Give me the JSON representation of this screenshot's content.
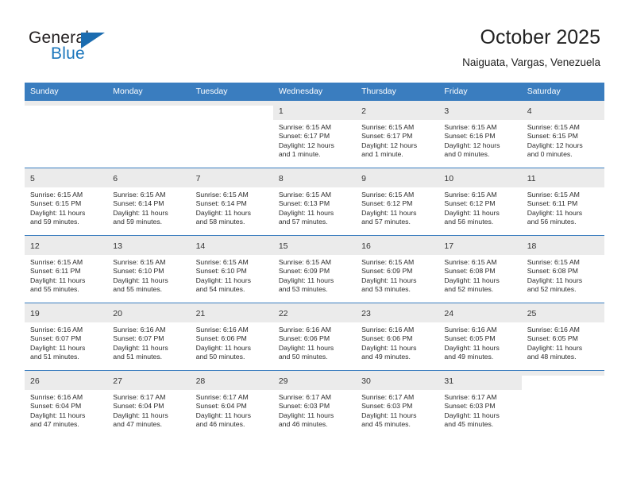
{
  "logo": {
    "word_top": "General",
    "word_bottom": "Blue",
    "triangle_icon": "triangle-icon",
    "brand_color": "#1b76bc"
  },
  "header": {
    "title": "October 2025",
    "subtitle": "Naiguata, Vargas, Venezuela"
  },
  "theme": {
    "header_bar_color": "#3a7dbf",
    "daynum_bar_color": "#ebebeb",
    "text_color": "#2b2b2b"
  },
  "weekday_headers": [
    "Sunday",
    "Monday",
    "Tuesday",
    "Wednesday",
    "Thursday",
    "Friday",
    "Saturday"
  ],
  "weeks": [
    [
      {
        "day": "",
        "sunrise": "",
        "sunset": "",
        "daylight1": "",
        "daylight2": ""
      },
      {
        "day": "",
        "sunrise": "",
        "sunset": "",
        "daylight1": "",
        "daylight2": ""
      },
      {
        "day": "",
        "sunrise": "",
        "sunset": "",
        "daylight1": "",
        "daylight2": ""
      },
      {
        "day": "1",
        "sunrise": "Sunrise: 6:15 AM",
        "sunset": "Sunset: 6:17 PM",
        "daylight1": "Daylight: 12 hours",
        "daylight2": "and 1 minute."
      },
      {
        "day": "2",
        "sunrise": "Sunrise: 6:15 AM",
        "sunset": "Sunset: 6:17 PM",
        "daylight1": "Daylight: 12 hours",
        "daylight2": "and 1 minute."
      },
      {
        "day": "3",
        "sunrise": "Sunrise: 6:15 AM",
        "sunset": "Sunset: 6:16 PM",
        "daylight1": "Daylight: 12 hours",
        "daylight2": "and 0 minutes."
      },
      {
        "day": "4",
        "sunrise": "Sunrise: 6:15 AM",
        "sunset": "Sunset: 6:15 PM",
        "daylight1": "Daylight: 12 hours",
        "daylight2": "and 0 minutes."
      }
    ],
    [
      {
        "day": "5",
        "sunrise": "Sunrise: 6:15 AM",
        "sunset": "Sunset: 6:15 PM",
        "daylight1": "Daylight: 11 hours",
        "daylight2": "and 59 minutes."
      },
      {
        "day": "6",
        "sunrise": "Sunrise: 6:15 AM",
        "sunset": "Sunset: 6:14 PM",
        "daylight1": "Daylight: 11 hours",
        "daylight2": "and 59 minutes."
      },
      {
        "day": "7",
        "sunrise": "Sunrise: 6:15 AM",
        "sunset": "Sunset: 6:14 PM",
        "daylight1": "Daylight: 11 hours",
        "daylight2": "and 58 minutes."
      },
      {
        "day": "8",
        "sunrise": "Sunrise: 6:15 AM",
        "sunset": "Sunset: 6:13 PM",
        "daylight1": "Daylight: 11 hours",
        "daylight2": "and 57 minutes."
      },
      {
        "day": "9",
        "sunrise": "Sunrise: 6:15 AM",
        "sunset": "Sunset: 6:12 PM",
        "daylight1": "Daylight: 11 hours",
        "daylight2": "and 57 minutes."
      },
      {
        "day": "10",
        "sunrise": "Sunrise: 6:15 AM",
        "sunset": "Sunset: 6:12 PM",
        "daylight1": "Daylight: 11 hours",
        "daylight2": "and 56 minutes."
      },
      {
        "day": "11",
        "sunrise": "Sunrise: 6:15 AM",
        "sunset": "Sunset: 6:11 PM",
        "daylight1": "Daylight: 11 hours",
        "daylight2": "and 56 minutes."
      }
    ],
    [
      {
        "day": "12",
        "sunrise": "Sunrise: 6:15 AM",
        "sunset": "Sunset: 6:11 PM",
        "daylight1": "Daylight: 11 hours",
        "daylight2": "and 55 minutes."
      },
      {
        "day": "13",
        "sunrise": "Sunrise: 6:15 AM",
        "sunset": "Sunset: 6:10 PM",
        "daylight1": "Daylight: 11 hours",
        "daylight2": "and 55 minutes."
      },
      {
        "day": "14",
        "sunrise": "Sunrise: 6:15 AM",
        "sunset": "Sunset: 6:10 PM",
        "daylight1": "Daylight: 11 hours",
        "daylight2": "and 54 minutes."
      },
      {
        "day": "15",
        "sunrise": "Sunrise: 6:15 AM",
        "sunset": "Sunset: 6:09 PM",
        "daylight1": "Daylight: 11 hours",
        "daylight2": "and 53 minutes."
      },
      {
        "day": "16",
        "sunrise": "Sunrise: 6:15 AM",
        "sunset": "Sunset: 6:09 PM",
        "daylight1": "Daylight: 11 hours",
        "daylight2": "and 53 minutes."
      },
      {
        "day": "17",
        "sunrise": "Sunrise: 6:15 AM",
        "sunset": "Sunset: 6:08 PM",
        "daylight1": "Daylight: 11 hours",
        "daylight2": "and 52 minutes."
      },
      {
        "day": "18",
        "sunrise": "Sunrise: 6:15 AM",
        "sunset": "Sunset: 6:08 PM",
        "daylight1": "Daylight: 11 hours",
        "daylight2": "and 52 minutes."
      }
    ],
    [
      {
        "day": "19",
        "sunrise": "Sunrise: 6:16 AM",
        "sunset": "Sunset: 6:07 PM",
        "daylight1": "Daylight: 11 hours",
        "daylight2": "and 51 minutes."
      },
      {
        "day": "20",
        "sunrise": "Sunrise: 6:16 AM",
        "sunset": "Sunset: 6:07 PM",
        "daylight1": "Daylight: 11 hours",
        "daylight2": "and 51 minutes."
      },
      {
        "day": "21",
        "sunrise": "Sunrise: 6:16 AM",
        "sunset": "Sunset: 6:06 PM",
        "daylight1": "Daylight: 11 hours",
        "daylight2": "and 50 minutes."
      },
      {
        "day": "22",
        "sunrise": "Sunrise: 6:16 AM",
        "sunset": "Sunset: 6:06 PM",
        "daylight1": "Daylight: 11 hours",
        "daylight2": "and 50 minutes."
      },
      {
        "day": "23",
        "sunrise": "Sunrise: 6:16 AM",
        "sunset": "Sunset: 6:06 PM",
        "daylight1": "Daylight: 11 hours",
        "daylight2": "and 49 minutes."
      },
      {
        "day": "24",
        "sunrise": "Sunrise: 6:16 AM",
        "sunset": "Sunset: 6:05 PM",
        "daylight1": "Daylight: 11 hours",
        "daylight2": "and 49 minutes."
      },
      {
        "day": "25",
        "sunrise": "Sunrise: 6:16 AM",
        "sunset": "Sunset: 6:05 PM",
        "daylight1": "Daylight: 11 hours",
        "daylight2": "and 48 minutes."
      }
    ],
    [
      {
        "day": "26",
        "sunrise": "Sunrise: 6:16 AM",
        "sunset": "Sunset: 6:04 PM",
        "daylight1": "Daylight: 11 hours",
        "daylight2": "and 47 minutes."
      },
      {
        "day": "27",
        "sunrise": "Sunrise: 6:17 AM",
        "sunset": "Sunset: 6:04 PM",
        "daylight1": "Daylight: 11 hours",
        "daylight2": "and 47 minutes."
      },
      {
        "day": "28",
        "sunrise": "Sunrise: 6:17 AM",
        "sunset": "Sunset: 6:04 PM",
        "daylight1": "Daylight: 11 hours",
        "daylight2": "and 46 minutes."
      },
      {
        "day": "29",
        "sunrise": "Sunrise: 6:17 AM",
        "sunset": "Sunset: 6:03 PM",
        "daylight1": "Daylight: 11 hours",
        "daylight2": "and 46 minutes."
      },
      {
        "day": "30",
        "sunrise": "Sunrise: 6:17 AM",
        "sunset": "Sunset: 6:03 PM",
        "daylight1": "Daylight: 11 hours",
        "daylight2": "and 45 minutes."
      },
      {
        "day": "31",
        "sunrise": "Sunrise: 6:17 AM",
        "sunset": "Sunset: 6:03 PM",
        "daylight1": "Daylight: 11 hours",
        "daylight2": "and 45 minutes."
      },
      {
        "day": "",
        "sunrise": "",
        "sunset": "",
        "daylight1": "",
        "daylight2": ""
      }
    ]
  ]
}
